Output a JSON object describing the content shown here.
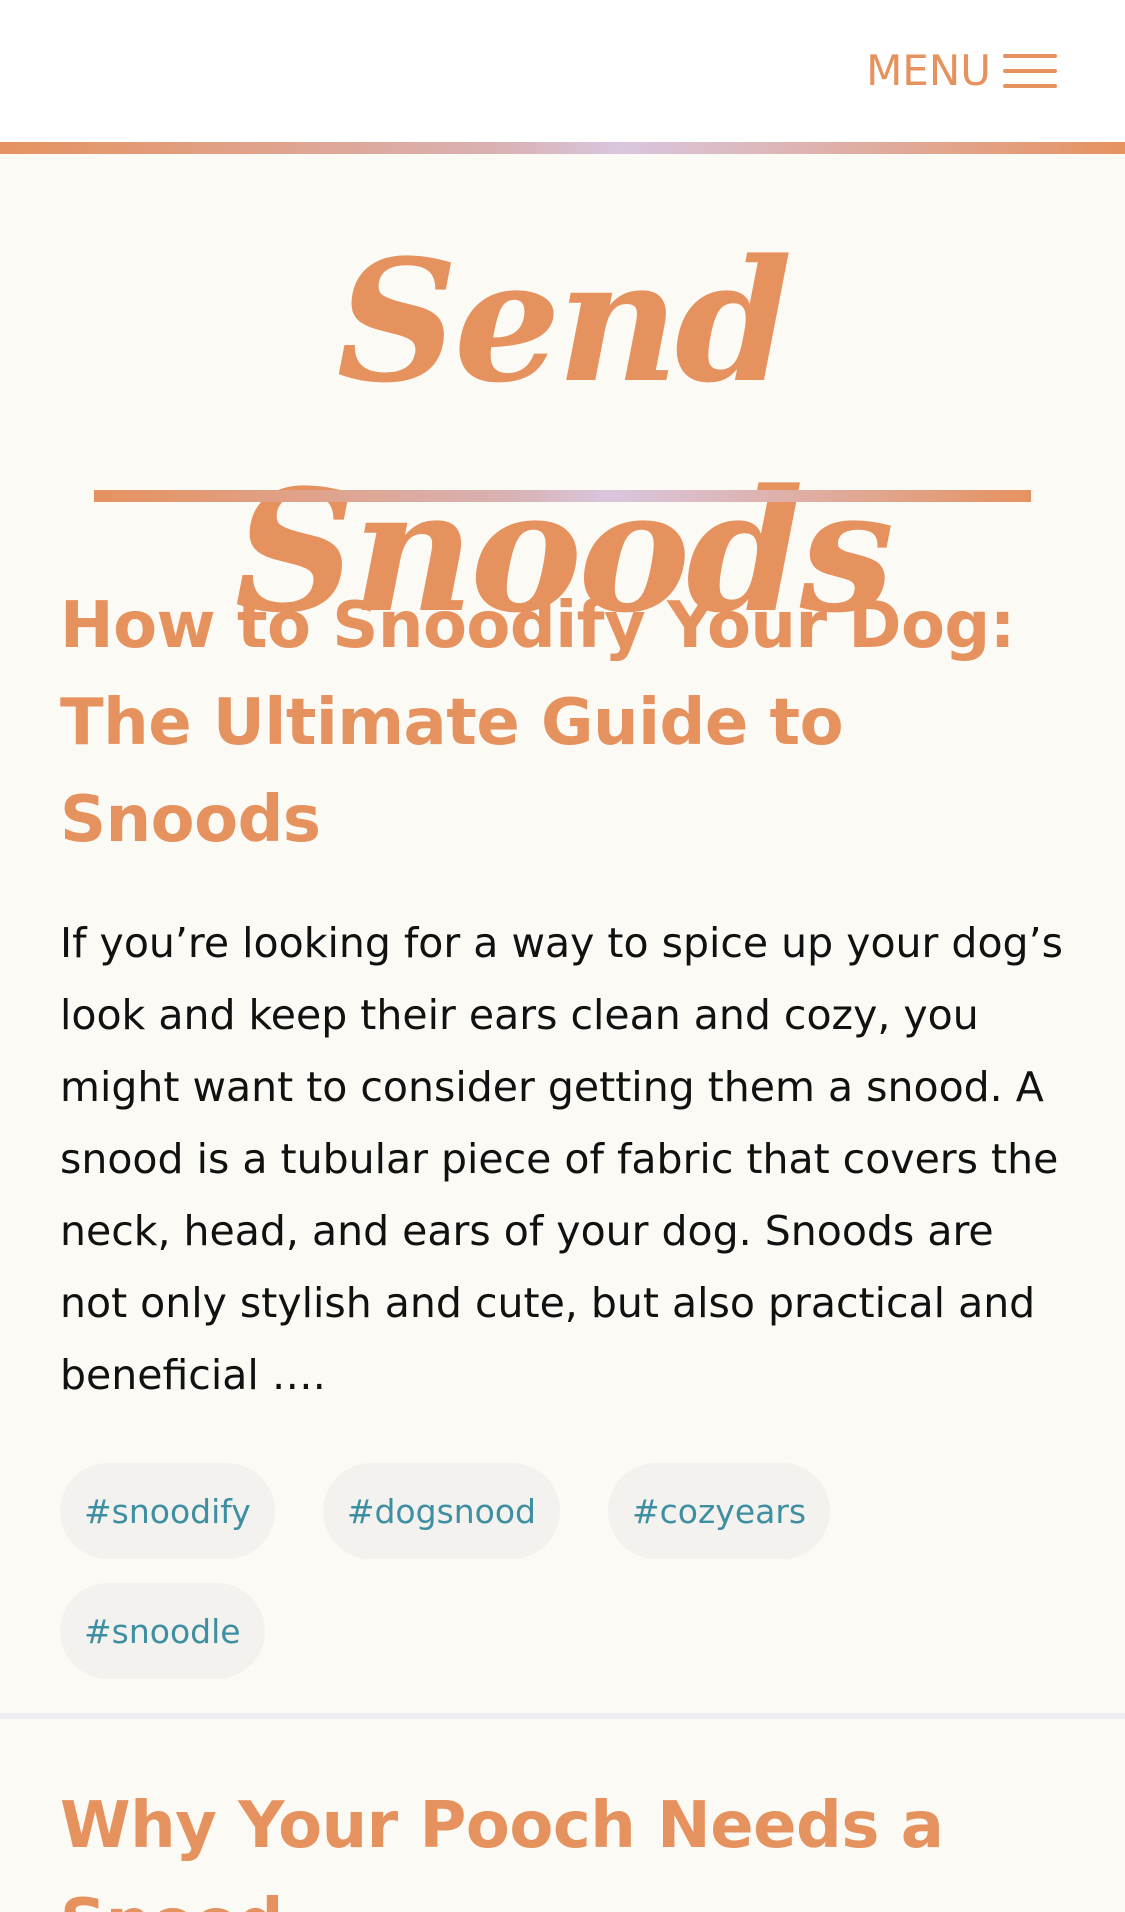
{
  "header": {
    "menu_label": "MENU",
    "menu_icon": "hamburger-menu-icon"
  },
  "site": {
    "title": "Send Snoods"
  },
  "articles": [
    {
      "title": "How to Snoodify Your Dog: The Ultimate Guide to Snoods",
      "excerpt": "If you’re looking for a way to spice up your dog’s look and keep their ears clean and cozy, you might want to consider getting them a snood. A snood is a tubular piece of fabric that covers the neck, head, and ears of your dog. Snoods are not only stylish and cute, but also practical and beneficial ….",
      "tags": [
        "#snoodify",
        "#dogsnood",
        "#cozyears",
        "#snoodle"
      ]
    },
    {
      "title": "Why Your Pooch Needs a Snood"
    }
  ],
  "colors": {
    "accent": "#e6925f",
    "tag_text": "#3f8fa3",
    "tag_bg": "#f3f2ef",
    "page_bg": "#fbfaf4"
  }
}
